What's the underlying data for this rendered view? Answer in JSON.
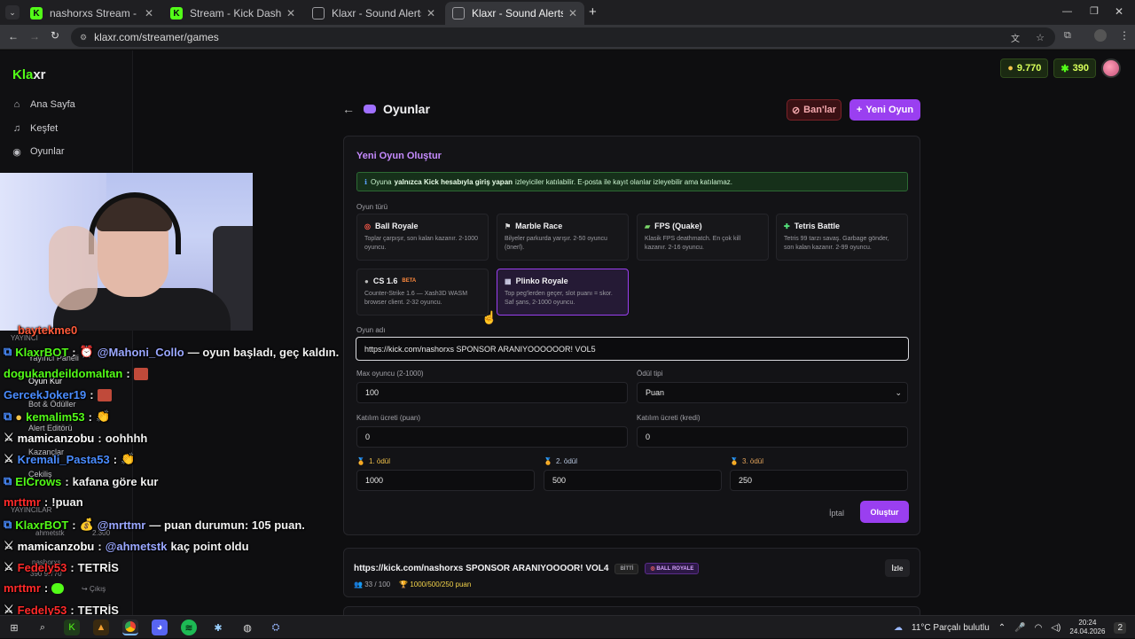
{
  "browser": {
    "tabs": [
      {
        "label": "nashorxs Stream - Watch Live o",
        "favicon": "kick-icon",
        "active": false
      },
      {
        "label": "Stream - Kick Dashboard",
        "favicon": "kick-icon",
        "active": false
      },
      {
        "label": "Klaxr - Sound Alerts",
        "favicon": "globe-icon",
        "active": false
      },
      {
        "label": "Klaxr - Sound Alerts",
        "favicon": "globe-icon",
        "active": true
      }
    ],
    "new_tab": "+",
    "url": "klaxr.com/streamer/games"
  },
  "sidebar": {
    "logo_a": "Kla",
    "logo_b": "xr",
    "items": [
      {
        "label": "Ana Sayfa",
        "icon": "home-icon"
      },
      {
        "label": "Keşfet",
        "icon": "music-icon"
      },
      {
        "label": "Oyunlar",
        "icon": "gamepad-icon"
      }
    ],
    "hidden_items": [
      "Yayıncı Paneli",
      "Oyun Kur",
      "Bot & Ödüller",
      "Alert Editörü",
      "Kazançlar",
      "Çekiliş"
    ],
    "section_label": "YAYINCI",
    "section_label_2": "YAYINCILAR",
    "user_name": "ahmetstk",
    "user_points": "2.300",
    "user2_name": "nashorxs",
    "user2_points": "390  9.770",
    "logout": "Çıkış"
  },
  "header": {
    "points": "9.770",
    "credits": "390"
  },
  "page": {
    "title": "Oyunlar",
    "ban_button": "Ban'lar",
    "new_game_button": "Yeni Oyun"
  },
  "form": {
    "title": "Yeni Oyun Oluştur",
    "notice_pre": "Oyuna",
    "notice_bold": "yalnızca Kick hesabıyla giriş yapan",
    "notice_post": "izleyiciler katılabilir. E-posta ile kayıt olanlar izleyebilir ama katılamaz.",
    "game_type_label": "Oyun türü",
    "games": [
      {
        "name": "Ball Royale",
        "desc": "Toplar çarpışır, son kalan kazanır. 2-1000 oyuncu.",
        "icon": "target-icon",
        "selected": false,
        "beta": ""
      },
      {
        "name": "Marble Race",
        "desc": "Bilyeler parkurda yarışır. 2-50 oyuncu (önerl).",
        "icon": "flag-icon",
        "selected": false,
        "beta": ""
      },
      {
        "name": "FPS (Quake)",
        "desc": "Klasik FPS deathmatch. En çok kill kazanır. 2-16 oyuncu.",
        "icon": "gun-icon",
        "selected": false,
        "beta": ""
      },
      {
        "name": "Tetris Battle",
        "desc": "Tetris 99 tarzı savaş. Garbage gönder, son kalan kazanır. 2-99 oyuncu.",
        "icon": "puzzle-icon",
        "selected": false,
        "beta": ""
      },
      {
        "name": "CS 1.6",
        "desc": "Counter-Strike 1.6 — Xash3D WASM browser client. 2-32 oyuncu.",
        "icon": "bomb-icon",
        "selected": false,
        "beta": "BETA"
      },
      {
        "name": "Plinko Royale",
        "desc": "Top peg'lerden geçer, slot puanı = skor. Saf şans, 2-1000 oyuncu.",
        "icon": "plinko-icon",
        "selected": true,
        "beta": ""
      }
    ],
    "name_label": "Oyun adı",
    "name_value": "https://kick.com/nashorxs SPONSOR ARANIYOOOOOOR! VOL5",
    "max_label": "Max oyuncu (2-1000)",
    "max_value": "100",
    "reward_type_label": "Ödül tipi",
    "reward_type_value": "Puan",
    "fee_points_label": "Katılım ücreti (puan)",
    "fee_points_value": "0",
    "fee_credits_label": "Katılım ücreti (kredi)",
    "fee_credits_value": "0",
    "prizes": [
      {
        "label": "1. ödül",
        "value": "1000",
        "color": "#f3c34a"
      },
      {
        "label": "2. ödül",
        "value": "500",
        "color": "#b8c7e0"
      },
      {
        "label": "3. ödül",
        "value": "250",
        "color": "#e0a25a"
      }
    ],
    "cancel": "İptal",
    "create": "Oluştur"
  },
  "games_list": [
    {
      "title": "https://kick.com/nashorxs SPONSOR ARANIYOOOOR! VOL4",
      "status": "BİTTİ",
      "type": "BALL ROYALE",
      "players": "33 / 100",
      "prizes": "1000/500/250 puan",
      "watch": "İzle"
    }
  ],
  "chat": [
    {
      "user": "baytekme0",
      "color": "#ff5a3a",
      "text": "",
      "mention": ""
    },
    {
      "user": "KlaxrBOT",
      "color": "#53fc18",
      "text": "— oyun başladı, geç kaldın.",
      "mention": "@Mahoni_Collo"
    },
    {
      "user": "dogukandeildomaltan",
      "color": "#53fc18",
      "text": "",
      "mention": ""
    },
    {
      "user": "GercekJoker19",
      "color": "#4a8cff",
      "text": "",
      "mention": ""
    },
    {
      "user": "kemalim53",
      "color": "#53fc18",
      "text": "",
      "mention": ""
    },
    {
      "user": "mamicanzobu",
      "color": "#ffffff",
      "text": "oohhhh",
      "mention": ""
    },
    {
      "user": "Kremali_Pasta53",
      "color": "#4a8cff",
      "text": "",
      "mention": ""
    },
    {
      "user": "ElCrows",
      "color": "#53fc18",
      "text": "kafana göre kur",
      "mention": ""
    },
    {
      "user": "mrttmr",
      "color": "#ff2a2a",
      "text": "!puan",
      "mention": ""
    },
    {
      "user": "KlaxrBOT",
      "color": "#53fc18",
      "text": "— puan durumun: 105 puan.",
      "mention": "@mrttmr"
    },
    {
      "user": "mamicanzobu",
      "color": "#ffffff",
      "text": "",
      "mention": "@ahmetstk",
      "tail": "kaç point oldu"
    },
    {
      "user": "Fedely53",
      "color": "#ff2a2a",
      "text": "TETRİS",
      "mention": ""
    },
    {
      "user": "mrttmr",
      "color": "#ff2a2a",
      "text": "",
      "mention": ""
    },
    {
      "user": "Fedely53",
      "color": "#ff2a2a",
      "text": "TETRİS",
      "mention": ""
    }
  ],
  "taskbar": {
    "weather": "11°C  Parçalı bulutlu",
    "time": "20:24",
    "date": "24.04.2026",
    "notif": "2"
  }
}
